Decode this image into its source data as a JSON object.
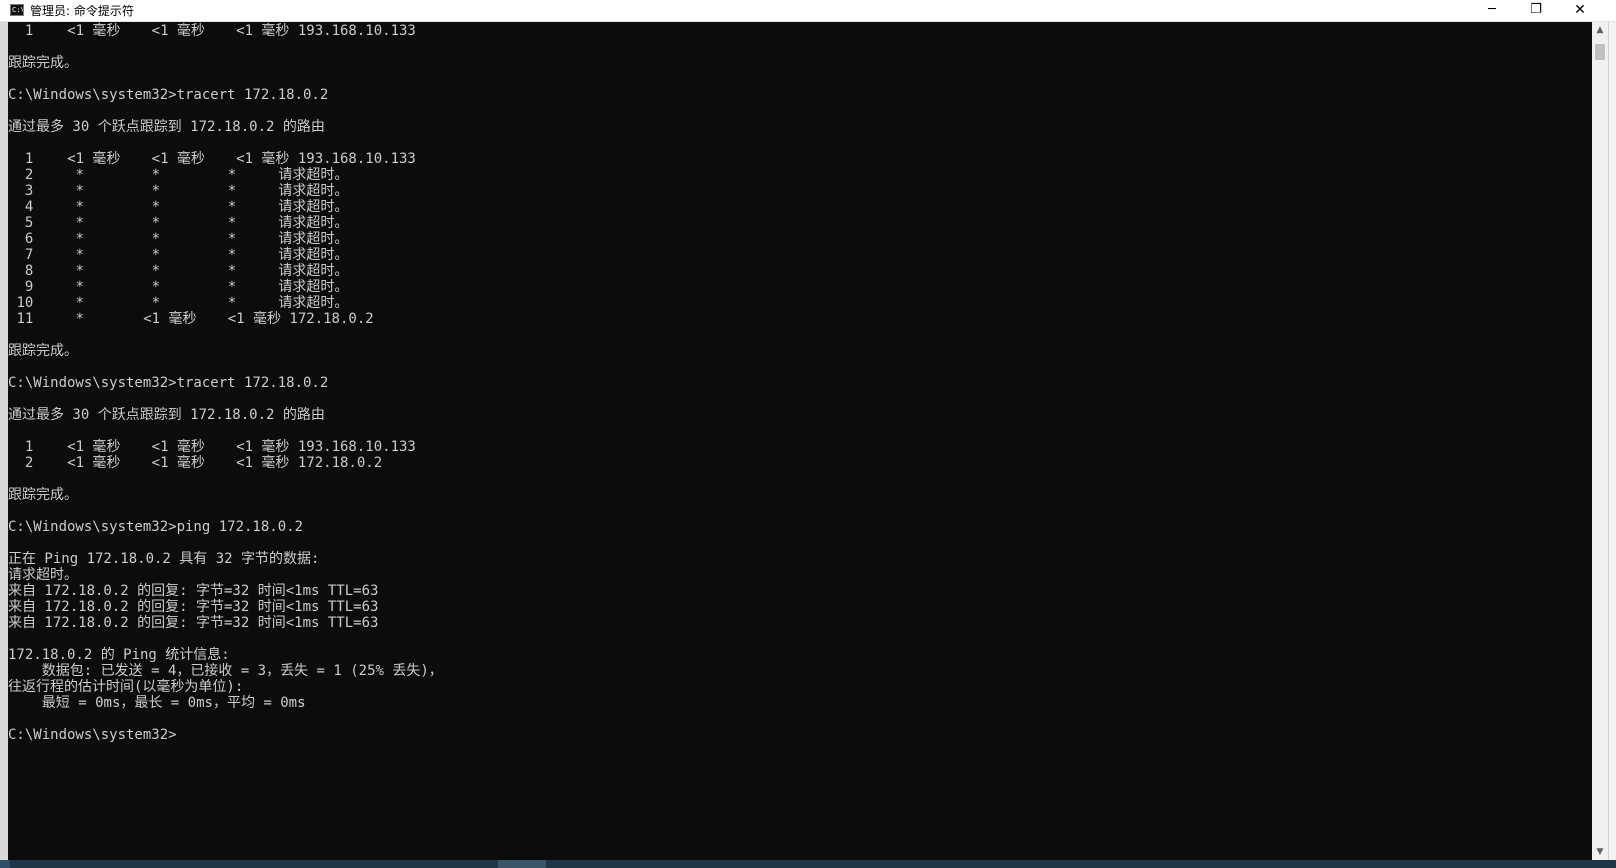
{
  "window": {
    "title": "管理员: 命令提示符",
    "icon": "cmd-icon",
    "controls": {
      "minimize": "─",
      "restore": "❐",
      "close": "✕"
    }
  },
  "scrollbar": {
    "up_arrow": "▲",
    "down_arrow": "▼"
  },
  "console": {
    "lines": [
      [
        {
          "col": 2,
          "t": "1"
        },
        {
          "col": 7,
          "t": "<1 毫秒"
        },
        {
          "col": 17,
          "t": "<1 毫秒"
        },
        {
          "col": 27,
          "t": "<1 毫秒 193.168.10.133"
        }
      ],
      [],
      [
        {
          "col": 0,
          "t": "跟踪完成。"
        }
      ],
      [],
      [
        {
          "col": 0,
          "t": "C:\\Windows\\system32>tracert 172.18.0.2"
        }
      ],
      [],
      [
        {
          "col": 0,
          "t": "通过最多 30 个跃点跟踪到 172.18.0.2 的路由"
        }
      ],
      [],
      [
        {
          "col": 2,
          "t": "1"
        },
        {
          "col": 7,
          "t": "<1 毫秒"
        },
        {
          "col": 17,
          "t": "<1 毫秒"
        },
        {
          "col": 27,
          "t": "<1 毫秒 193.168.10.133"
        }
      ],
      [
        {
          "col": 2,
          "t": "2"
        },
        {
          "col": 8,
          "t": "*"
        },
        {
          "col": 17,
          "t": "*"
        },
        {
          "col": 26,
          "t": "*"
        },
        {
          "col": 32,
          "t": "请求超时。"
        }
      ],
      [
        {
          "col": 2,
          "t": "3"
        },
        {
          "col": 8,
          "t": "*"
        },
        {
          "col": 17,
          "t": "*"
        },
        {
          "col": 26,
          "t": "*"
        },
        {
          "col": 32,
          "t": "请求超时。"
        }
      ],
      [
        {
          "col": 2,
          "t": "4"
        },
        {
          "col": 8,
          "t": "*"
        },
        {
          "col": 17,
          "t": "*"
        },
        {
          "col": 26,
          "t": "*"
        },
        {
          "col": 32,
          "t": "请求超时。"
        }
      ],
      [
        {
          "col": 2,
          "t": "5"
        },
        {
          "col": 8,
          "t": "*"
        },
        {
          "col": 17,
          "t": "*"
        },
        {
          "col": 26,
          "t": "*"
        },
        {
          "col": 32,
          "t": "请求超时。"
        }
      ],
      [
        {
          "col": 2,
          "t": "6"
        },
        {
          "col": 8,
          "t": "*"
        },
        {
          "col": 17,
          "t": "*"
        },
        {
          "col": 26,
          "t": "*"
        },
        {
          "col": 32,
          "t": "请求超时。"
        }
      ],
      [
        {
          "col": 2,
          "t": "7"
        },
        {
          "col": 8,
          "t": "*"
        },
        {
          "col": 17,
          "t": "*"
        },
        {
          "col": 26,
          "t": "*"
        },
        {
          "col": 32,
          "t": "请求超时。"
        }
      ],
      [
        {
          "col": 2,
          "t": "8"
        },
        {
          "col": 8,
          "t": "*"
        },
        {
          "col": 17,
          "t": "*"
        },
        {
          "col": 26,
          "t": "*"
        },
        {
          "col": 32,
          "t": "请求超时。"
        }
      ],
      [
        {
          "col": 2,
          "t": "9"
        },
        {
          "col": 8,
          "t": "*"
        },
        {
          "col": 17,
          "t": "*"
        },
        {
          "col": 26,
          "t": "*"
        },
        {
          "col": 32,
          "t": "请求超时。"
        }
      ],
      [
        {
          "col": 1,
          "t": "10"
        },
        {
          "col": 8,
          "t": "*"
        },
        {
          "col": 17,
          "t": "*"
        },
        {
          "col": 26,
          "t": "*"
        },
        {
          "col": 32,
          "t": "请求超时。"
        }
      ],
      [
        {
          "col": 1,
          "t": "11"
        },
        {
          "col": 8,
          "t": "*"
        },
        {
          "col": 16,
          "t": "<1 毫秒"
        },
        {
          "col": 26,
          "t": "<1 毫秒 172.18.0.2"
        }
      ],
      [],
      [
        {
          "col": 0,
          "t": "跟踪完成。"
        }
      ],
      [],
      [
        {
          "col": 0,
          "t": "C:\\Windows\\system32>tracert 172.18.0.2"
        }
      ],
      [],
      [
        {
          "col": 0,
          "t": "通过最多 30 个跃点跟踪到 172.18.0.2 的路由"
        }
      ],
      [],
      [
        {
          "col": 2,
          "t": "1"
        },
        {
          "col": 7,
          "t": "<1 毫秒"
        },
        {
          "col": 17,
          "t": "<1 毫秒"
        },
        {
          "col": 27,
          "t": "<1 毫秒 193.168.10.133"
        }
      ],
      [
        {
          "col": 2,
          "t": "2"
        },
        {
          "col": 7,
          "t": "<1 毫秒"
        },
        {
          "col": 17,
          "t": "<1 毫秒"
        },
        {
          "col": 27,
          "t": "<1 毫秒 172.18.0.2"
        }
      ],
      [],
      [
        {
          "col": 0,
          "t": "跟踪完成。"
        }
      ],
      [],
      [
        {
          "col": 0,
          "t": "C:\\Windows\\system32>ping 172.18.0.2"
        }
      ],
      [],
      [
        {
          "col": 0,
          "t": "正在 Ping 172.18.0.2 具有 32 字节的数据:"
        }
      ],
      [
        {
          "col": 0,
          "t": "请求超时。"
        }
      ],
      [
        {
          "col": 0,
          "t": "来自 172.18.0.2 的回复: 字节=32 时间<1ms TTL=63"
        }
      ],
      [
        {
          "col": 0,
          "t": "来自 172.18.0.2 的回复: 字节=32 时间<1ms TTL=63"
        }
      ],
      [
        {
          "col": 0,
          "t": "来自 172.18.0.2 的回复: 字节=32 时间<1ms TTL=63"
        }
      ],
      [],
      [
        {
          "col": 0,
          "t": "172.18.0.2 的 Ping 统计信息:"
        }
      ],
      [
        {
          "col": 4,
          "t": "数据包: 已发送 = 4，已接收 = 3，丢失 = 1 (25% 丢失)，"
        }
      ],
      [
        {
          "col": 0,
          "t": "往返行程的估计时间(以毫秒为单位):"
        }
      ],
      [
        {
          "col": 4,
          "t": "最短 = 0ms，最长 = 0ms，平均 = 0ms"
        }
      ],
      [],
      [
        {
          "col": 0,
          "t": "C:\\Windows\\system32>"
        }
      ]
    ]
  }
}
